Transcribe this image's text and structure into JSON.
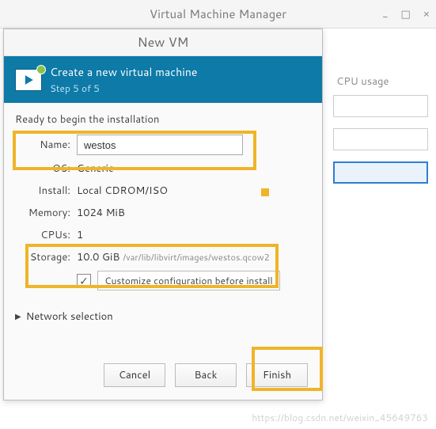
{
  "mainWindow": {
    "title": "Virtual Machine Manager",
    "minimize": "_",
    "maximize": "□",
    "close": "×",
    "cpuHeader": "CPU usage"
  },
  "dialog": {
    "title": "New VM",
    "headerTitle": "Create a new virtual machine",
    "stepText": "Step 5 of 5",
    "readyText": "Ready to begin the installation",
    "labels": {
      "name": "Name:",
      "os": "OS:",
      "install": "Install:",
      "memory": "Memory:",
      "cpus": "CPUs:",
      "storage": "Storage:"
    },
    "values": {
      "name": "westos",
      "os": "Generic",
      "install": "Local CDROM/ISO",
      "memory": "1024 MiB",
      "cpus": "1",
      "storageSize": "10.0 GiB",
      "storagePath": "/var/lib/libvirt/images/westos.qcow2"
    },
    "customize": {
      "checked": "✓",
      "label": "Customize configuration before install"
    },
    "networkExpander": "Network selection",
    "buttons": {
      "cancel": "Cancel",
      "back": "Back",
      "finish": "Finish"
    }
  },
  "watermark": "https://blog.csdn.net/weixin_45649763"
}
